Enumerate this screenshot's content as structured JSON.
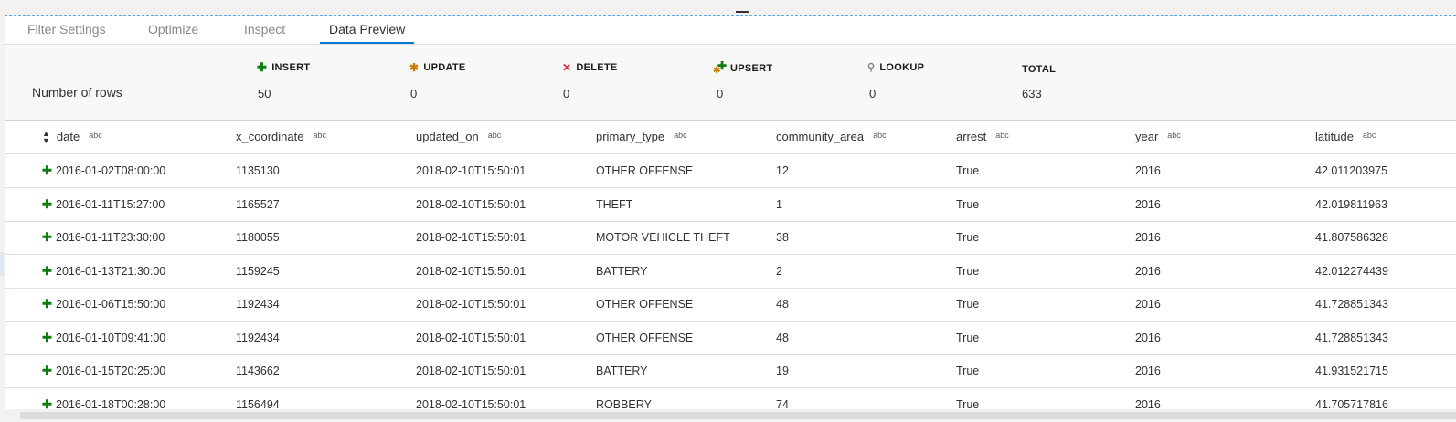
{
  "tabs": [
    {
      "label": "Filter Settings"
    },
    {
      "label": "Optimize"
    },
    {
      "label": "Inspect"
    },
    {
      "label": "Data Preview",
      "active": true
    }
  ],
  "summary": {
    "row_label": "Number of rows",
    "stats": [
      {
        "label": "INSERT",
        "value": "50",
        "icon": "plus-icon"
      },
      {
        "label": "UPDATE",
        "value": "0",
        "icon": "asterisk-icon"
      },
      {
        "label": "DELETE",
        "value": "0",
        "icon": "x-icon"
      },
      {
        "label": "UPSERT",
        "value": "0",
        "icon": "plus-asterisk-icon"
      },
      {
        "label": "LOOKUP",
        "value": "0",
        "icon": "search-icon"
      },
      {
        "label": "TOTAL",
        "value": "633"
      }
    ]
  },
  "grid": {
    "type_badge": "abc",
    "columns": [
      "date",
      "x_coordinate",
      "updated_on",
      "primary_type",
      "community_area",
      "arrest",
      "year",
      "latitude"
    ],
    "rows": [
      [
        "2016-01-02T08:00:00",
        "1135130",
        "2018-02-10T15:50:01",
        "OTHER OFFENSE",
        "12",
        "True",
        "2016",
        "42.011203975"
      ],
      [
        "2016-01-11T15:27:00",
        "1165527",
        "2018-02-10T15:50:01",
        "THEFT",
        "1",
        "True",
        "2016",
        "42.019811963"
      ],
      [
        "2016-01-11T23:30:00",
        "1180055",
        "2018-02-10T15:50:01",
        "MOTOR VEHICLE THEFT",
        "38",
        "True",
        "2016",
        "41.807586328"
      ],
      [
        "2016-01-13T21:30:00",
        "1159245",
        "2018-02-10T15:50:01",
        "BATTERY",
        "2",
        "True",
        "2016",
        "42.012274439"
      ],
      [
        "2016-01-06T15:50:00",
        "1192434",
        "2018-02-10T15:50:01",
        "OTHER OFFENSE",
        "48",
        "True",
        "2016",
        "41.728851343"
      ],
      [
        "2016-01-10T09:41:00",
        "1192434",
        "2018-02-10T15:50:01",
        "OTHER OFFENSE",
        "48",
        "True",
        "2016",
        "41.728851343"
      ],
      [
        "2016-01-15T20:25:00",
        "1143662",
        "2018-02-10T15:50:01",
        "BATTERY",
        "19",
        "True",
        "2016",
        "41.931521715"
      ],
      [
        "2016-01-18T00:28:00",
        "1156494",
        "2018-02-10T15:50:01",
        "ROBBERY",
        "74",
        "True",
        "2016",
        "41.705717816"
      ]
    ]
  },
  "colors": {
    "accent": "#0078d4",
    "insert": "#107c10",
    "update": "#ca7b00",
    "delete": "#d13438"
  }
}
